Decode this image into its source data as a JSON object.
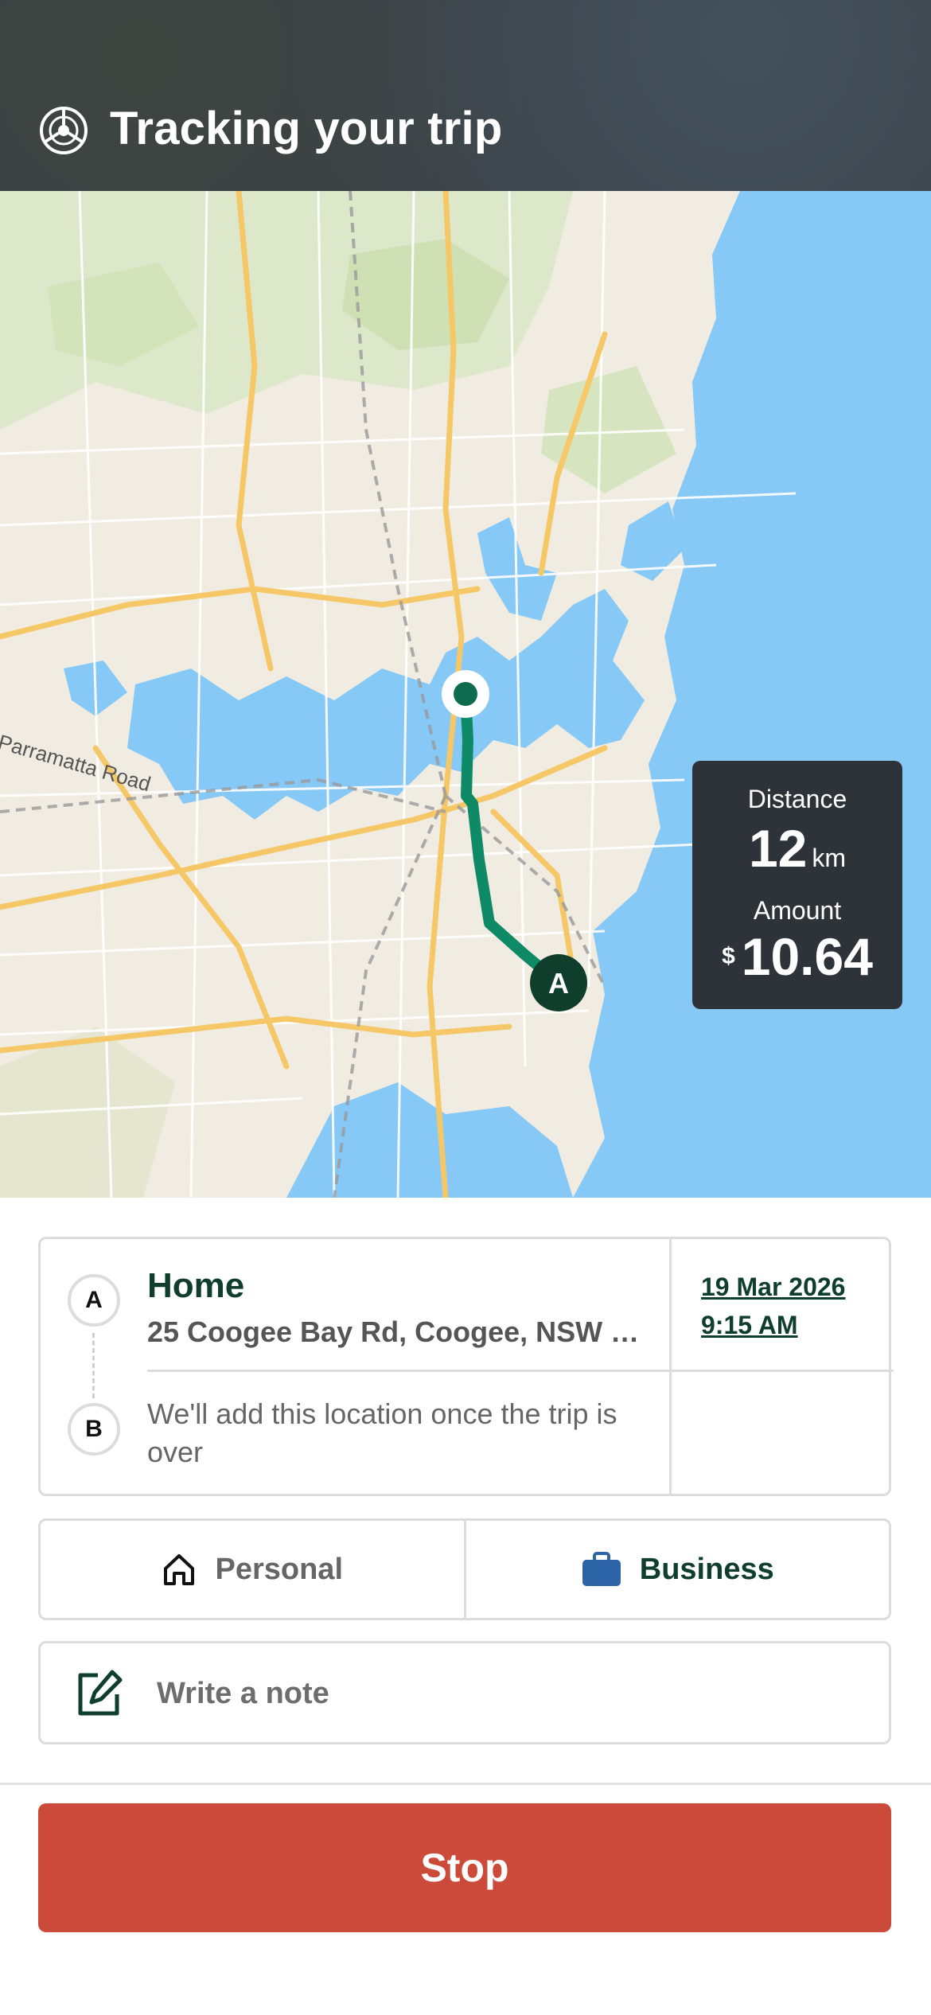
{
  "header": {
    "title": "Tracking your trip",
    "icon": "steering-wheel-icon"
  },
  "map": {
    "road_label": "Parramatta Road",
    "start_marker_label": "A",
    "stats": {
      "distance_label": "Distance",
      "distance_value": "12",
      "distance_unit": "km",
      "amount_label": "Amount",
      "currency": "$",
      "amount_value": "10.64"
    }
  },
  "locations": {
    "start": {
      "pin": "A",
      "name": "Home",
      "address": "25 Coogee Bay Rd, Coogee, NSW 2...",
      "date": "19 Mar 2026",
      "time": "9:15 AM"
    },
    "end": {
      "pin": "B",
      "pending_text": "We'll add this location once the trip is over"
    }
  },
  "trip_type": {
    "personal_label": "Personal",
    "business_label": "Business",
    "selected": "Business"
  },
  "note": {
    "placeholder": "Write a note"
  },
  "actions": {
    "stop_label": "Stop"
  },
  "colors": {
    "header_bg": "#3a4045",
    "route": "#0f8a67",
    "brand_dark": "#0f3e2d",
    "stop": "#cc4a3a",
    "water": "#86c8f6",
    "business_icon": "#2d64a8"
  }
}
